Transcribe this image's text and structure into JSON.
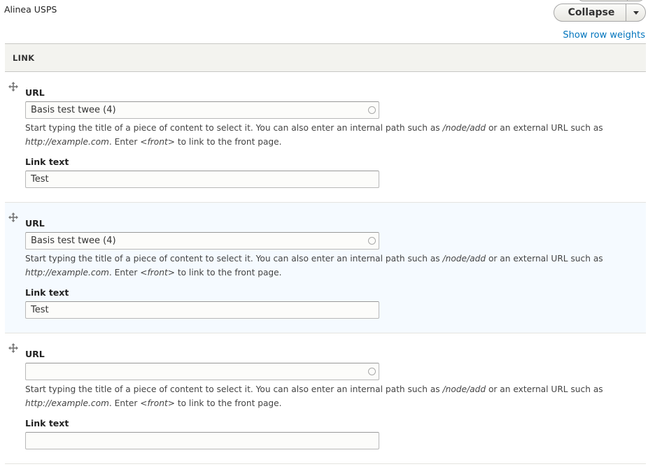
{
  "page": {
    "title": "Alinea USPS"
  },
  "toolbar": {
    "collapse_label": "Collapse",
    "show_row_weights_label": "Show row weights"
  },
  "table": {
    "header": "LINK",
    "rows": [
      {
        "url_label": "URL",
        "url_value": "Basis test twee (4)",
        "description": {
          "part1": "Start typing the title of a piece of content to select it. You can also enter an internal path such as ",
          "path_example": "/node/add",
          "part2": " or an external URL such as ",
          "url_example": "http://example.com",
          "part3": ". Enter ",
          "front_token": "<front>",
          "part4": " to link to the front page."
        },
        "link_text_label": "Link text",
        "link_text_value": "Test"
      },
      {
        "url_label": "URL",
        "url_value": "Basis test twee (4)",
        "description": {
          "part1": "Start typing the title of a piece of content to select it. You can also enter an internal path such as ",
          "path_example": "/node/add",
          "part2": " or an external URL such as ",
          "url_example": "http://example.com",
          "part3": ". Enter ",
          "front_token": "<front>",
          "part4": " to link to the front page."
        },
        "link_text_label": "Link text",
        "link_text_value": "Test"
      },
      {
        "url_label": "URL",
        "url_value": "",
        "description": {
          "part1": "Start typing the title of a piece of content to select it. You can also enter an internal path such as ",
          "path_example": "/node/add",
          "part2": " or an external URL such as ",
          "url_example": "http://example.com",
          "part3": ". Enter ",
          "front_token": "<front>",
          "part4": " to link to the front page."
        },
        "link_text_label": "Link text",
        "link_text_value": ""
      }
    ]
  },
  "colors": {
    "link": "#0074bd",
    "header_bg": "#f3f3ef",
    "highlight_row_bg": "#f5faff"
  }
}
